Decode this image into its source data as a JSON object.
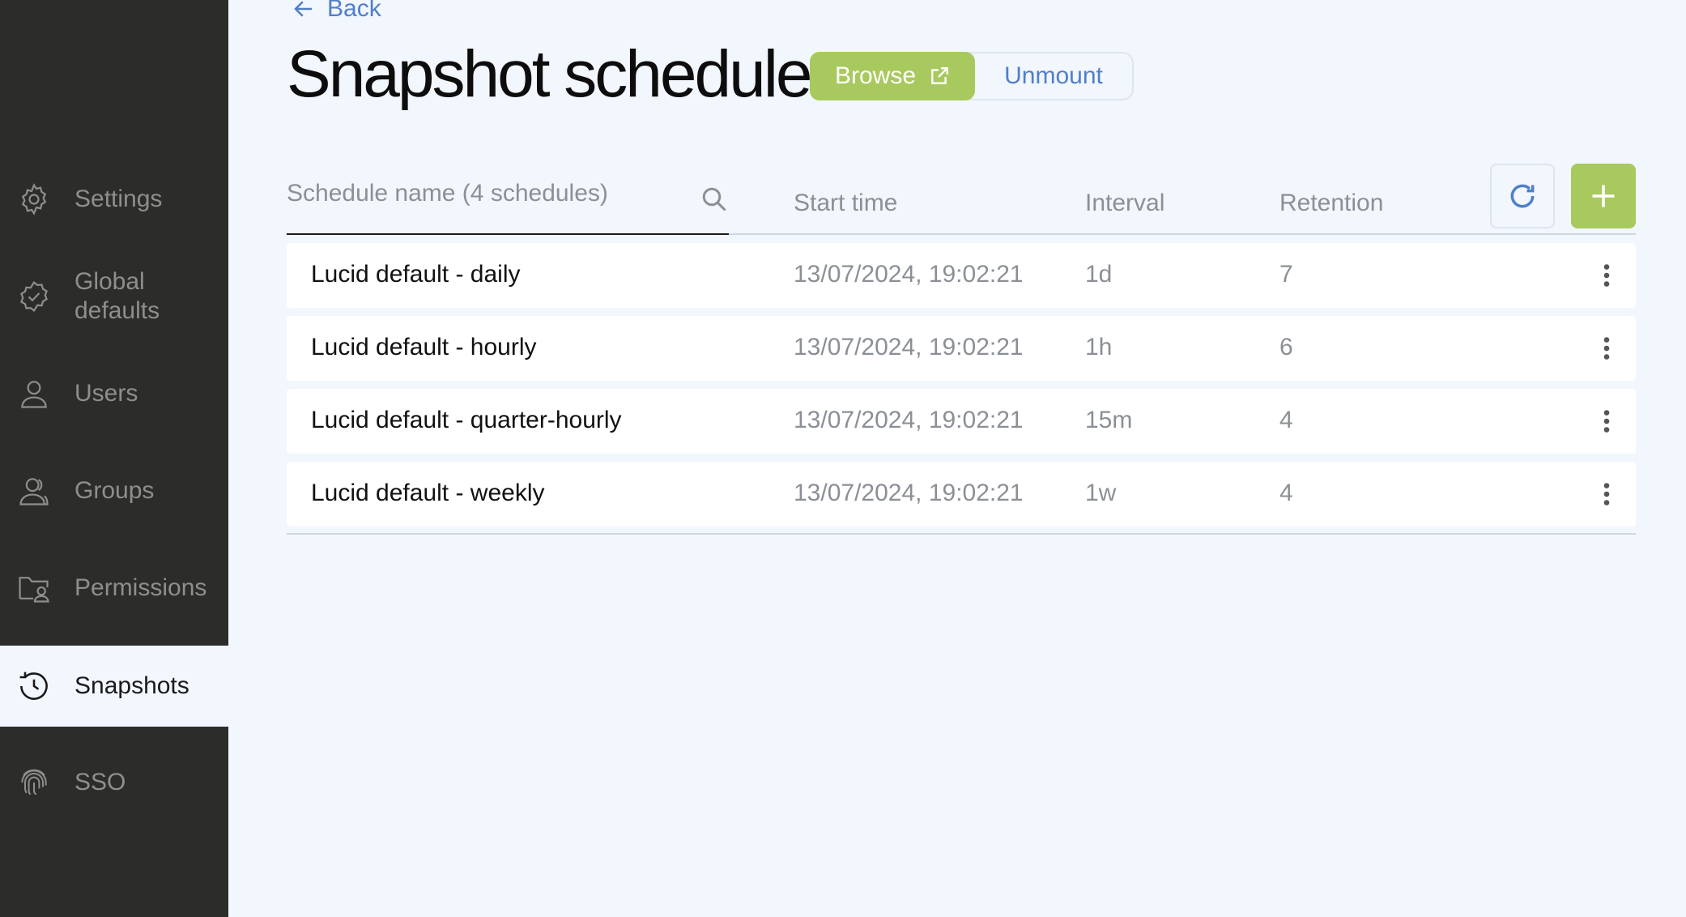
{
  "sidebar": {
    "items": [
      {
        "label": "Settings",
        "icon": "gear-icon"
      },
      {
        "label": "Global\ndefaults",
        "icon": "badge-check-icon"
      },
      {
        "label": "Users",
        "icon": "user-icon"
      },
      {
        "label": "Groups",
        "icon": "users-icon"
      },
      {
        "label": "Permissions",
        "icon": "folder-user-icon"
      },
      {
        "label": "Snapshots",
        "icon": "history-icon",
        "active": true
      },
      {
        "label": "SSO",
        "icon": "fingerprint-icon"
      }
    ]
  },
  "header": {
    "back_label": "Back",
    "title": "Snapshot schedule",
    "browse_label": "Browse",
    "unmount_label": "Unmount"
  },
  "table": {
    "search_placeholder": "Schedule name (4 schedules)",
    "columns": {
      "start": "Start time",
      "interval": "Interval",
      "retention": "Retention"
    },
    "rows": [
      {
        "name": "Lucid default - daily",
        "start": "13/07/2024, 19:02:21",
        "interval": "1d",
        "retention": "7"
      },
      {
        "name": "Lucid default - hourly",
        "start": "13/07/2024, 19:02:21",
        "interval": "1h",
        "retention": "6"
      },
      {
        "name": "Lucid default - quarter-hourly",
        "start": "13/07/2024, 19:02:21",
        "interval": "15m",
        "retention": "4"
      },
      {
        "name": "Lucid default - weekly",
        "start": "13/07/2024, 19:02:21",
        "interval": "1w",
        "retention": "4"
      }
    ]
  },
  "colors": {
    "sidebar_bg": "#2c2d2b",
    "page_bg": "#f2f6fd",
    "accent_green": "#a8c95e",
    "link_blue": "#4f7fc9"
  }
}
